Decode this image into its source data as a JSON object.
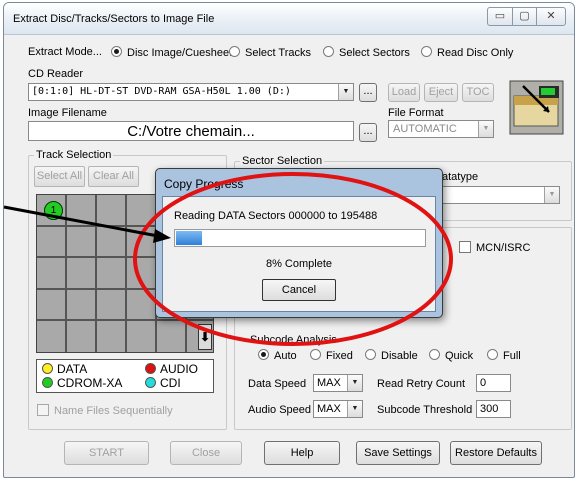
{
  "window": {
    "title": "Extract Disc/Tracks/Sectors to Image File",
    "controls": {
      "minimize": "▭",
      "maximize": "▢",
      "close": "✕"
    }
  },
  "extract_mode": {
    "label": "Extract Mode...",
    "options": [
      "Disc Image/Cuesheet",
      "Select Tracks",
      "Select Sectors",
      "Read Disc Only"
    ],
    "selected": "Disc Image/Cuesheet"
  },
  "cd_reader": {
    "label": "CD Reader",
    "value": "[0:1:0] HL-DT-ST DVD-RAM GSA-H50L 1.00 (D:)",
    "browse": "...",
    "load": "Load",
    "eject": "Eject",
    "toc": "TOC"
  },
  "image_filename": {
    "label": "Image Filename",
    "value": "C:/Votre chemain...",
    "browse": "..."
  },
  "file_format": {
    "label": "File Format",
    "value": "AUTOMATIC"
  },
  "track_selection": {
    "label": "Track Selection",
    "select_all": "Select All",
    "clear_all": "Clear All",
    "first_track": "1",
    "legend": {
      "data": "DATA",
      "audio": "AUDIO",
      "cdrom_xa": "CDROM-XA",
      "cdi": "CDI"
    },
    "name_files_sequentially": "Name Files Sequentially"
  },
  "sector_selection": {
    "label": "Sector Selection",
    "datatype_fragment": "atatype",
    "mcn_isrc": "MCN/ISRC"
  },
  "subcode_analysis": {
    "label": "Subcode Analysis",
    "options": [
      "Auto",
      "Fixed",
      "Disable",
      "Quick",
      "Full"
    ],
    "selected": "Auto"
  },
  "speeds": {
    "data_speed_label": "Data Speed",
    "data_speed": "MAX",
    "audio_speed_label": "Audio Speed",
    "audio_speed": "MAX",
    "retry_label": "Read Retry Count",
    "retry_value": "0",
    "threshold_label": "Subcode Threshold",
    "threshold_value": "300"
  },
  "buttons": {
    "start": "START",
    "close": "Close",
    "help": "Help",
    "save_settings": "Save Settings",
    "restore_defaults": "Restore Defaults"
  },
  "dialog": {
    "title": "Copy Progress",
    "status": "Reading DATA Sectors 000000 to 195488",
    "progress_fraction": 0.08,
    "complete_text": "8% Complete",
    "cancel": "Cancel"
  },
  "colors": {
    "progress_fill": "#3d8fe0",
    "highlight_ring": "#e01212",
    "track_green": "#22cc22",
    "data_yellow": "#ffee22",
    "audio_red": "#dd1111",
    "cdrom_xa_green": "#22cc22",
    "cdi_cyan": "#22dddd"
  }
}
